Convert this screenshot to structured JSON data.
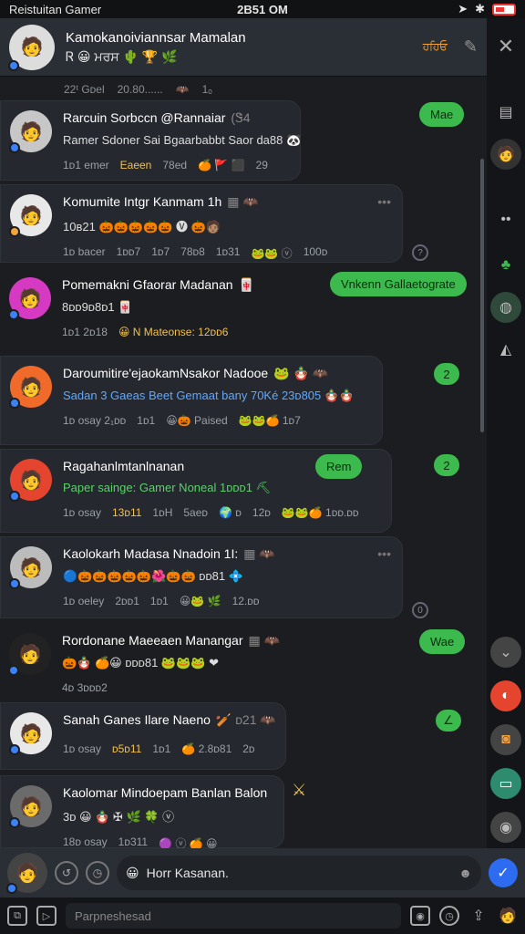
{
  "status": {
    "app": "Reistuitan Gamer",
    "time": "2B51 OM"
  },
  "header": {
    "title": "Kamokanoiviannsar Mamalan",
    "subtitle": "Ꮢ 😀 ਮਰਸ 🌵 🏆 🌿",
    "tag": "ਹਹਿਓ",
    "avatar_emoji": "🧑"
  },
  "colors": {
    "accent": "#3dba4e",
    "header_bg": "#2a2e35",
    "send": "#2d6bf0"
  },
  "feed": {
    "top_meta": [
      "22ᵗ Gᴅel",
      "20.80......",
      "🦇",
      "1ₒ"
    ],
    "messages": [
      {
        "name": "Rarcuin Sorbccn @Rannaiar",
        "name_icon": "(Ꮥ4",
        "line": "Ramer Sdoner Sai Bgaarbabbt Saor da88 🐼",
        "meta": [
          "1ᴅ1 emer",
          "Eaeen",
          "78ed",
          "🍊 🚩 ⬛",
          "29"
        ],
        "avatar": "🧑"
      },
      {
        "name": "Komumite Intgr Kanmam 1h",
        "name_icon": "▦ 🦇",
        "line": "10ʙ21 🎃🎃🎃🎃🎃 🅥 🎃🧑🏽",
        "meta": [
          "1ᴅ bacer",
          "1ᴅᴅ7",
          "1ᴅ7",
          "78ᴅ8",
          "1ᴅ31",
          "🐸🐸 ⓥ",
          "100ᴅ"
        ],
        "avatar": "🧑"
      },
      {
        "name": "Pomemakni Gfaorar Madanan",
        "name_icon": "🀄",
        "line": "8ᴅᴅ9ᴅ8ᴅ1 🀄",
        "meta": [
          "1ᴅ1 2ᴅ18",
          "😀 N Mateonse: 12ᴅᴅ6"
        ],
        "avatar": "🧑"
      },
      {
        "name": "Daroumitire'ejaokamNsakor Nadooe",
        "name_icon": "🐸 🪆 🦇",
        "line": "Sadan 3 Gaeas Beet Gemaat bany 70Ké 23ᴅ805 🪆🪆",
        "meta": [
          "1ᴅ osay 2₁ᴅᴅ",
          "1ᴅ1",
          "😀🎃 Paised",
          "🐸🐸🍊 1ᴅ7"
        ],
        "avatar": "🧑"
      },
      {
        "name": "Ragahanlmtanlnanan",
        "name_icon": "",
        "line": "Paper sainge: Gamer Noneal 1ᴅᴅᴅ1 ⛏",
        "meta": [
          "1ᴅ osay",
          "13ᴅ11",
          "1ᴅH",
          "5aeᴅ",
          "🌍 ᴅ",
          "12ᴅ",
          "🐸🐸🍊 1ᴅᴅ.ᴅᴅ"
        ],
        "avatar": "🧑"
      },
      {
        "name": "Kaolokarh Madasa Nnadoin 1I:",
        "name_icon": "▦ 🦇",
        "line": "🔵🎃🎃🎃🎃🎃🌺🎃🎃 ᴅᴅ81 💠",
        "meta": [
          "1ᴅ oeley",
          "2ᴅᴅ1",
          "1ᴅ1",
          "😀🐸 🌿",
          "12.ᴅᴅ"
        ],
        "avatar": "🧑"
      },
      {
        "name": "Rordonane Maeeaen Manangar",
        "name_icon": "▦ 🦇",
        "line": "🎃🪆 🍊😀 ᴅᴅᴅ81 🐸🐸🐸 ❤",
        "meta": [
          "4ᴅ 3ᴅᴅᴅ2"
        ],
        "avatar": "🧑"
      },
      {
        "name": "Sanah Ganes Ilare Naeno",
        "name_icon": "🏏 ᴅ21 🦇",
        "line": "",
        "meta": [
          "1ᴅ osay",
          "ᴅ5ᴅ11",
          "1ᴅ1",
          "🍊 2.8ᴅ81",
          "2ᴅ"
        ],
        "avatar": "🧑"
      },
      {
        "name": "Kaolomar Mindoepam Banlan Balon",
        "name_icon": "",
        "line": "3ᴅ 😀 🪆 ✠ 🌿 🍀 ⓥ",
        "meta": [
          "18ᴅ osay",
          "1ᴅ311",
          "🟣 ⓥ 🍊 😀"
        ],
        "avatar": "🧑"
      }
    ],
    "outgoing": [
      {
        "text": "Mae"
      },
      {
        "text": "Vnkenn Gallaetograte"
      },
      {
        "text": "2"
      },
      {
        "text": "Rem"
      },
      {
        "text": "2"
      },
      {
        "text": "Wae"
      },
      {
        "text": "∠"
      }
    ]
  },
  "composer": {
    "placeholder": "Horr Kasanan.",
    "emoji": "😀"
  },
  "toolbar": {
    "field": "Parpneshesad"
  }
}
